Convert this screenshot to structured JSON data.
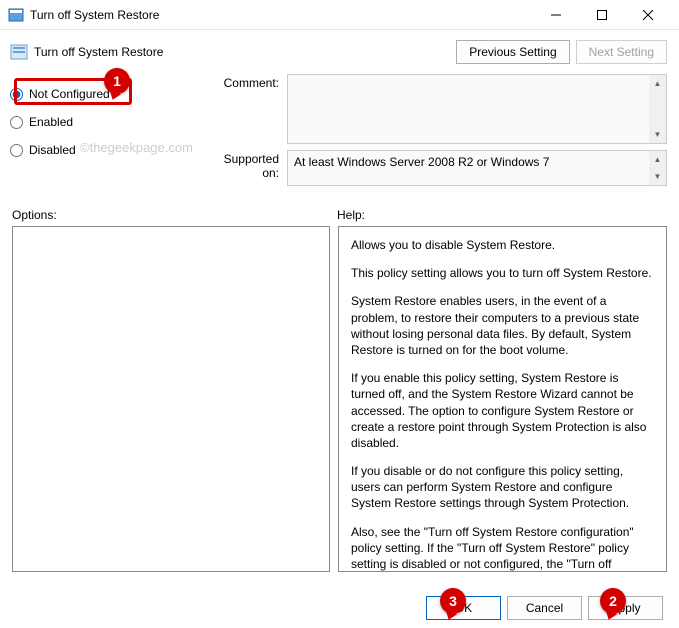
{
  "window": {
    "title": "Turn off System Restore"
  },
  "header": {
    "title": "Turn off System Restore",
    "prev_btn": "Previous Setting",
    "next_btn": "Next Setting"
  },
  "radios": {
    "not_configured": "Not Configured",
    "enabled": "Enabled",
    "disabled": "Disabled"
  },
  "fields": {
    "comment_label": "Comment:",
    "supported_label": "Supported on:",
    "supported_text": "At least Windows Server 2008 R2 or Windows 7"
  },
  "watermark": "©thegeekpage.com",
  "panels": {
    "options_label": "Options:",
    "help_label": "Help:"
  },
  "help": {
    "p1": "Allows you to disable System Restore.",
    "p2": "This policy setting allows you to turn off System Restore.",
    "p3": "System Restore enables users, in the event of a problem, to restore their computers to a previous state without losing personal data files. By default, System Restore is turned on for the boot volume.",
    "p4": "If you enable this policy setting, System Restore is turned off, and the System Restore Wizard cannot be accessed. The option to configure System Restore or create a restore point through System Protection is also disabled.",
    "p5": "If you disable or do not configure this policy setting, users can perform System Restore and configure System Restore settings through System Protection.",
    "p6": "Also, see the \"Turn off System Restore configuration\" policy setting. If the \"Turn off System Restore\" policy setting is disabled or not configured, the \"Turn off System Restore configuration\""
  },
  "buttons": {
    "ok": "OK",
    "cancel": "Cancel",
    "apply": "Apply"
  },
  "callouts": {
    "c1": "1",
    "c2": "2",
    "c3": "3"
  }
}
